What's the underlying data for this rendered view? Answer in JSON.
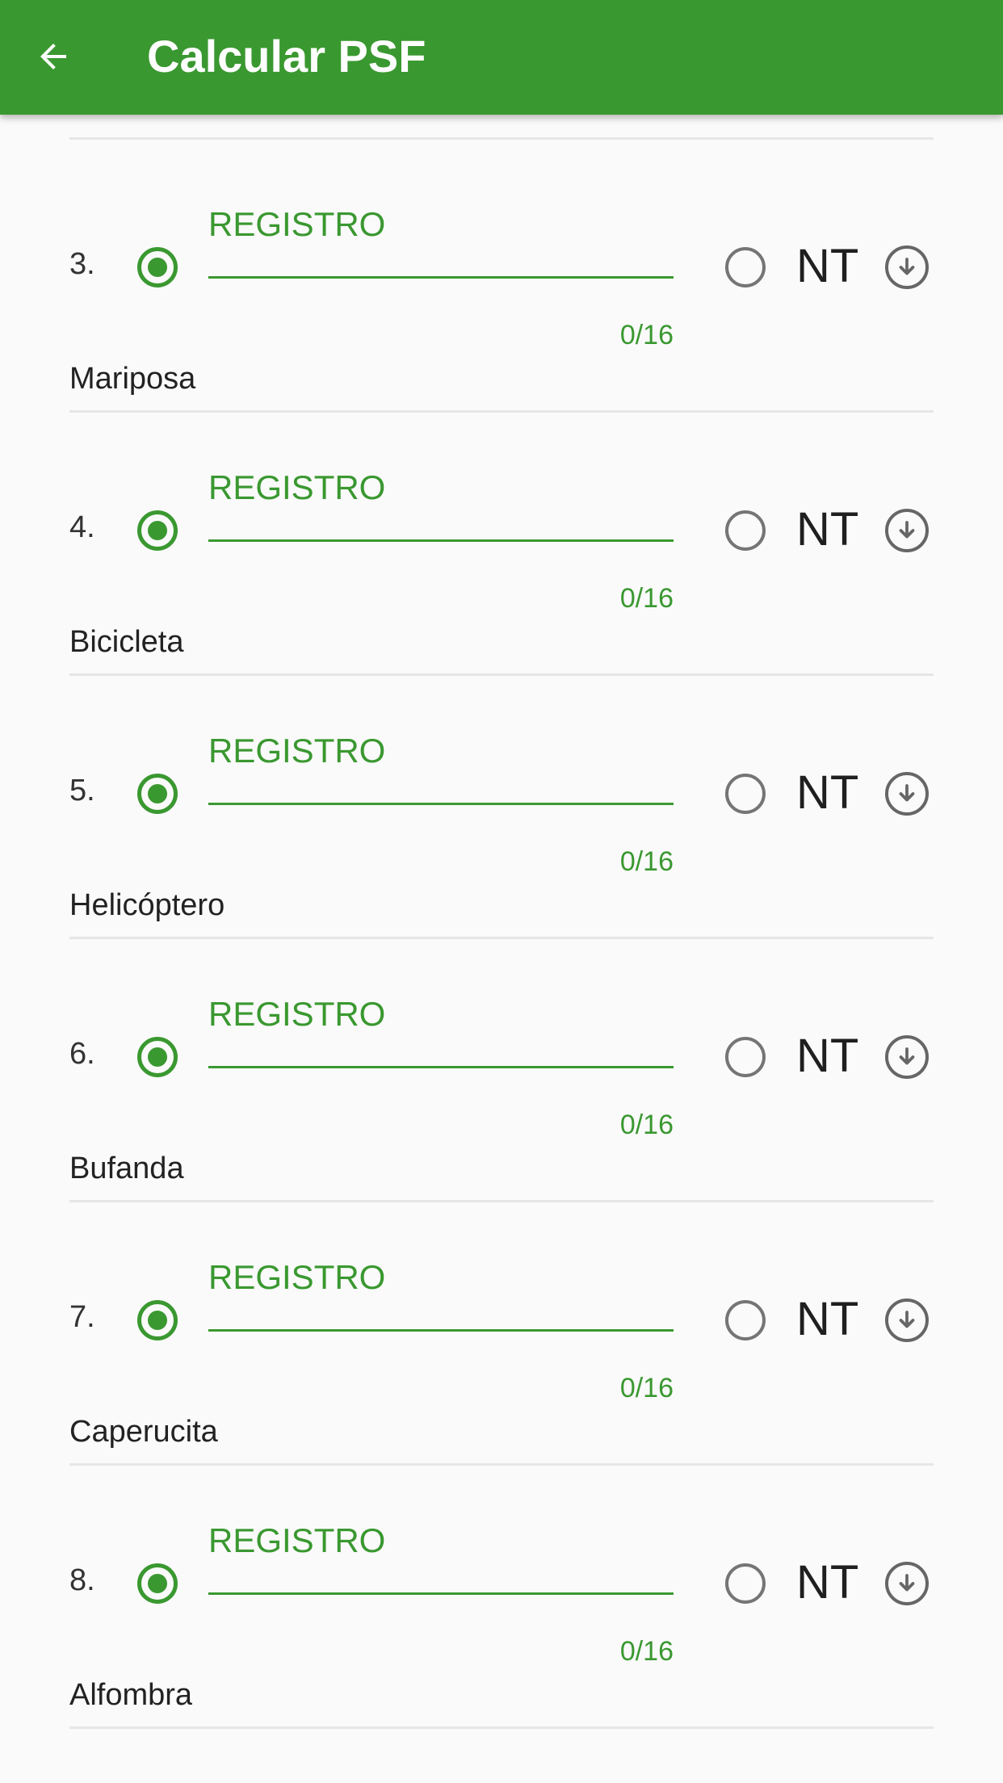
{
  "appbar": {
    "title": "Calcular PSF",
    "back_icon": "arrow-left-icon",
    "background": "#3a9830"
  },
  "colors": {
    "accent": "#3a9830",
    "divider": "#e6e6e6",
    "text": "#222222"
  },
  "items": [
    {
      "number": "3.",
      "field_label": "REGISTRO",
      "counter": "0/16",
      "nt_label": "NT",
      "word": "Mariposa",
      "registro_selected": true
    },
    {
      "number": "4.",
      "field_label": "REGISTRO",
      "counter": "0/16",
      "nt_label": "NT",
      "word": "Bicicleta",
      "registro_selected": true
    },
    {
      "number": "5.",
      "field_label": "REGISTRO",
      "counter": "0/16",
      "nt_label": "NT",
      "word": "Helicóptero",
      "registro_selected": true
    },
    {
      "number": "6.",
      "field_label": "REGISTRO",
      "counter": "0/16",
      "nt_label": "NT",
      "word": "Bufanda",
      "registro_selected": true
    },
    {
      "number": "7.",
      "field_label": "REGISTRO",
      "counter": "0/16",
      "nt_label": "NT",
      "word": "Caperucita",
      "registro_selected": true
    },
    {
      "number": "8.",
      "field_label": "REGISTRO",
      "counter": "0/16",
      "nt_label": "NT",
      "word": "Alfombra",
      "registro_selected": true
    }
  ]
}
